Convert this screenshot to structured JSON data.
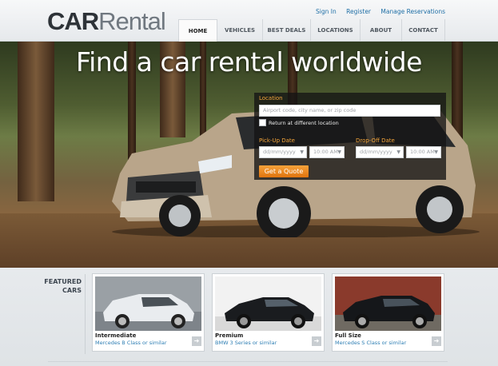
{
  "header": {
    "logo_car": "CAR",
    "logo_rental": "Rental",
    "top_links": [
      "Sign In",
      "Register",
      "Manage Reservations"
    ],
    "nav": [
      {
        "label": "HOME",
        "active": true
      },
      {
        "label": "VEHICLES",
        "active": false
      },
      {
        "label": "BEST DEALS",
        "active": false
      },
      {
        "label": "LOCATIONS",
        "active": false
      },
      {
        "label": "ABOUT",
        "active": false
      },
      {
        "label": "CONTACT",
        "active": false
      }
    ]
  },
  "hero": {
    "headline": "Find a car rental worldwide"
  },
  "form": {
    "location_label": "Location",
    "location_placeholder": "Airport code, city name, or zip code",
    "return_label": "Return at different location",
    "pickup_label": "Pick-Up Date",
    "dropoff_label": "Drop-Off Date",
    "pickup_date": "dd/mm/yyyy",
    "pickup_time": "10:00 AM",
    "dropoff_date": "dd/mm/yyyy",
    "dropoff_time": "10:00 AM",
    "quote_button": "Get a Quote",
    "accent": "#f3a43a"
  },
  "featured": {
    "title_line1": "FEATURED",
    "title_line2": "CARS",
    "cards": [
      {
        "name": "Intermediate",
        "model": "Mercedes B Class or similar",
        "car_color": "#e9ecef"
      },
      {
        "name": "Premium",
        "model": "BMW 3 Series or similar",
        "car_color": "#1a1c1f"
      },
      {
        "name": "Full Size",
        "model": "Mercedes S Class or similar",
        "car_color": "#15171a"
      }
    ]
  }
}
